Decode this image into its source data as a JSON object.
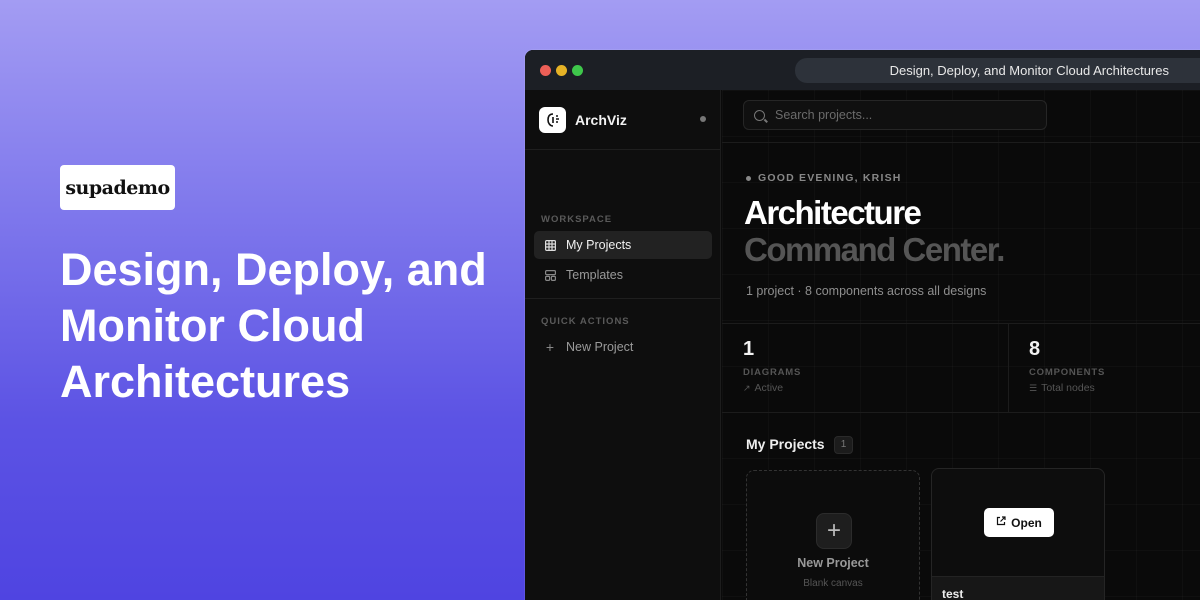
{
  "brand": {
    "name": "supademo"
  },
  "hero": {
    "title": "Design, Deploy, and Monitor Cloud Architectures"
  },
  "window": {
    "title": "Design, Deploy, and Monitor Cloud Architectures"
  },
  "sidebar": {
    "app_name": "ArchViz",
    "workspace_label": "WORKSPACE",
    "items": [
      {
        "label": "My Projects",
        "icon": "grid-icon",
        "active": true
      },
      {
        "label": "Templates",
        "icon": "template-icon",
        "active": false
      }
    ],
    "quick_actions_label": "QUICK ACTIONS",
    "quick_actions": [
      {
        "label": "New Project",
        "icon": "plus-icon"
      }
    ]
  },
  "search": {
    "placeholder": "Search projects..."
  },
  "dashboard": {
    "greeting": "GOOD EVENING, KRISH",
    "headline_line1": "Architecture",
    "headline_line2": "Command Center.",
    "summary": "1 project · 8 components across all designs"
  },
  "stats": [
    {
      "value": "1",
      "label": "DIAGRAMS",
      "sub": "Active",
      "icon": "trend-up-icon"
    },
    {
      "value": "8",
      "label": "COMPONENTS",
      "sub": "Total nodes",
      "icon": "server-icon"
    }
  ],
  "projects": {
    "title": "My Projects",
    "count": "1",
    "new_card": {
      "label": "New Project",
      "sub": "Blank canvas"
    },
    "items": [
      {
        "name": "test",
        "open_label": "Open"
      }
    ]
  }
}
